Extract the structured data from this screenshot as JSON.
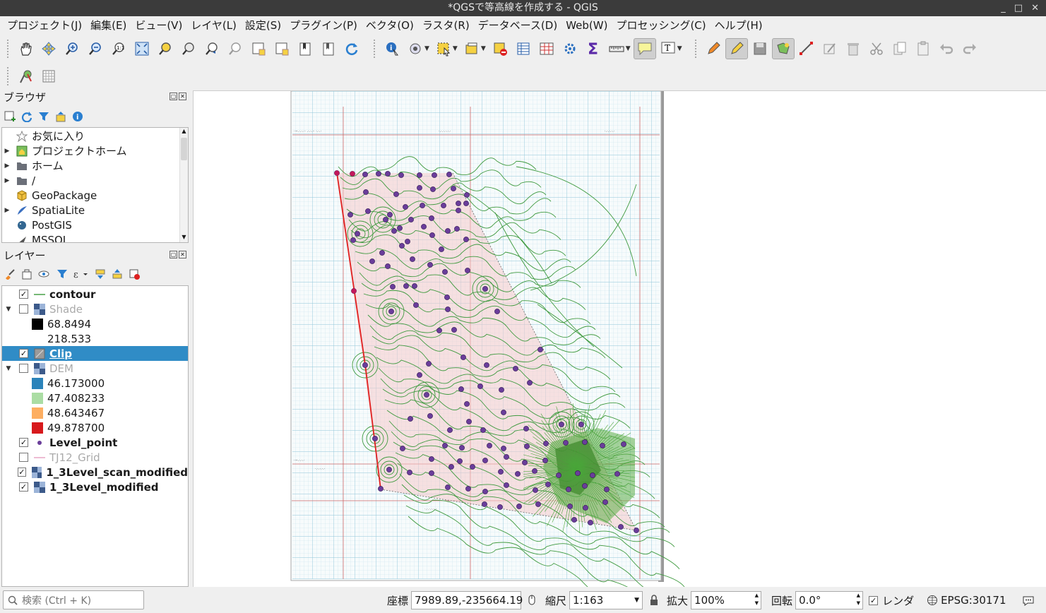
{
  "window": {
    "title": "*QGSで等高線を作成する - QGIS",
    "controls": [
      "_",
      "□",
      "✕"
    ]
  },
  "menu": [
    "プロジェクト(J)",
    "編集(E)",
    "ビュー(V)",
    "レイヤ(L)",
    "設定(S)",
    "プラグイン(P)",
    "ベクタ(O)",
    "ラスタ(R)",
    "データベース(D)",
    "Web(W)",
    "プロセッシング(C)",
    "ヘルプ(H)"
  ],
  "browser": {
    "title": "ブラウザ",
    "items": [
      {
        "label": "お気に入り",
        "icon": "star-icon",
        "expand": false
      },
      {
        "label": "プロジェクトホーム",
        "icon": "project-home-icon",
        "expand": true
      },
      {
        "label": "ホーム",
        "icon": "folder-icon",
        "expand": true
      },
      {
        "label": "/",
        "icon": "folder-icon",
        "expand": true
      },
      {
        "label": "GeoPackage",
        "icon": "geopackage-icon",
        "expand": false
      },
      {
        "label": "SpatiaLite",
        "icon": "spatialite-icon",
        "expand": true
      },
      {
        "label": "PostGIS",
        "icon": "postgis-icon",
        "expand": false
      },
      {
        "label": "MSSQL",
        "icon": "mssql-icon",
        "expand": false
      }
    ]
  },
  "layers": {
    "title": "レイヤー",
    "items": [
      {
        "name": "contour",
        "checked": true,
        "bold": true,
        "dim": false,
        "legend": "line",
        "color": "#3a9a3a",
        "indent": 1
      },
      {
        "name": "Shade",
        "checked": false,
        "bold": false,
        "dim": true,
        "legend": "raster",
        "expand": true,
        "indent": 0
      },
      {
        "name": "68.8494",
        "legend": "swatch",
        "color": "#000000",
        "indent": 2
      },
      {
        "name": "218.533",
        "legend": "none",
        "indent": 2
      },
      {
        "name": "Clip",
        "checked": true,
        "bold": true,
        "dim": false,
        "legend": "polygon",
        "color": "#999999",
        "selected": true,
        "indent": 1
      },
      {
        "name": "DEM",
        "checked": false,
        "bold": false,
        "dim": true,
        "legend": "raster",
        "expand": true,
        "indent": 0
      },
      {
        "name": "46.173000",
        "legend": "swatch",
        "color": "#2b83ba",
        "indent": 2
      },
      {
        "name": "47.408233",
        "legend": "swatch",
        "color": "#abdda4",
        "indent": 2
      },
      {
        "name": "48.643467",
        "legend": "swatch",
        "color": "#fdae61",
        "indent": 2
      },
      {
        "name": "49.878700",
        "legend": "swatch",
        "color": "#d7191c",
        "indent": 2
      },
      {
        "name": "Level_point",
        "checked": true,
        "bold": true,
        "dim": false,
        "legend": "point",
        "color": "#6a3d9a",
        "indent": 1
      },
      {
        "name": "TJ12_Grid",
        "checked": false,
        "bold": false,
        "dim": true,
        "legend": "line",
        "color": "#e6a0c0",
        "indent": 1
      },
      {
        "name": "1_3Level_scan_modified",
        "checked": true,
        "bold": true,
        "dim": false,
        "legend": "raster",
        "indent": 1
      },
      {
        "name": "1_3Level_modified",
        "checked": true,
        "bold": true,
        "dim": false,
        "legend": "raster",
        "indent": 1
      }
    ]
  },
  "status": {
    "search_placeholder": "検索 (Ctrl + K)",
    "coord_label": "座標",
    "coord_value": "7989.89,-235664.19",
    "scale_label": "縮尺",
    "scale_value": "1:163",
    "magnify_label": "拡大",
    "magnify_value": "100%",
    "rotation_label": "回転",
    "rotation_value": "0.0°",
    "render_label": "レンダ",
    "render_checked": true,
    "crs": "EPSG:30171"
  }
}
